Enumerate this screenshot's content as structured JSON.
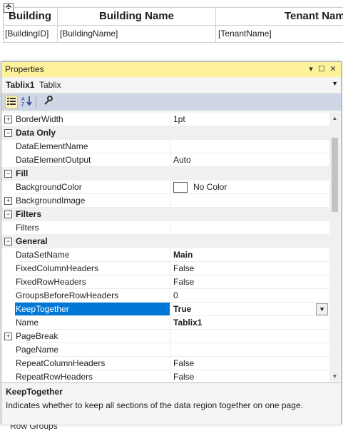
{
  "designer": {
    "headers": [
      "Building",
      "Building Name",
      "Tenant Nam"
    ],
    "details": [
      "[BuildingID]",
      "[BuildingName]",
      "[TenantName]"
    ],
    "row_groups_label": "Row Groups"
  },
  "properties_window": {
    "title": "Properties",
    "object_name": "Tablix1",
    "object_type": "Tablix",
    "rows": [
      {
        "kind": "prop",
        "expander": "+",
        "name": "BorderWidth",
        "value": "1pt"
      },
      {
        "kind": "cat",
        "expander": "−",
        "name": "Data Only"
      },
      {
        "kind": "prop",
        "name": "DataElementName",
        "value": ""
      },
      {
        "kind": "prop",
        "name": "DataElementOutput",
        "value": "Auto"
      },
      {
        "kind": "cat",
        "expander": "−",
        "name": "Fill"
      },
      {
        "kind": "prop",
        "name": "BackgroundColor",
        "value": "No Color",
        "swatch": true
      },
      {
        "kind": "prop",
        "expander": "+",
        "name": "BackgroundImage",
        "value": ""
      },
      {
        "kind": "cat",
        "expander": "−",
        "name": "Filters"
      },
      {
        "kind": "prop",
        "name": "Filters",
        "value": ""
      },
      {
        "kind": "cat",
        "expander": "−",
        "name": "General"
      },
      {
        "kind": "prop",
        "name": "DataSetName",
        "value": "Main",
        "bold": true
      },
      {
        "kind": "prop",
        "name": "FixedColumnHeaders",
        "value": "False"
      },
      {
        "kind": "prop",
        "name": "FixedRowHeaders",
        "value": "False"
      },
      {
        "kind": "prop",
        "name": "GroupsBeforeRowHeaders",
        "value": "0"
      },
      {
        "kind": "prop",
        "name": "KeepTogether",
        "value": "True",
        "bold": true,
        "selected": true,
        "dropdown": true
      },
      {
        "kind": "prop",
        "name": "Name",
        "value": "Tablix1",
        "bold": true
      },
      {
        "kind": "prop",
        "expander": "+",
        "name": "PageBreak",
        "value": ""
      },
      {
        "kind": "prop",
        "name": "PageName",
        "value": ""
      },
      {
        "kind": "prop",
        "name": "RepeatColumnHeaders",
        "value": "False"
      },
      {
        "kind": "prop",
        "name": "RepeatRowHeaders",
        "value": "False"
      }
    ],
    "description": {
      "title": "KeepTogether",
      "text": "Indicates whether to keep all sections of the data region together on one page."
    }
  },
  "colors": {
    "title_bar": "#fff29d",
    "selection": "#0078d7",
    "toolbar": "#cfd6e5"
  },
  "icons": [
    "categorized-icon",
    "alphabetical-icon",
    "property-pages-icon",
    "pin-icon",
    "maximize-icon",
    "close-icon",
    "dropdown-arrow-icon"
  ]
}
